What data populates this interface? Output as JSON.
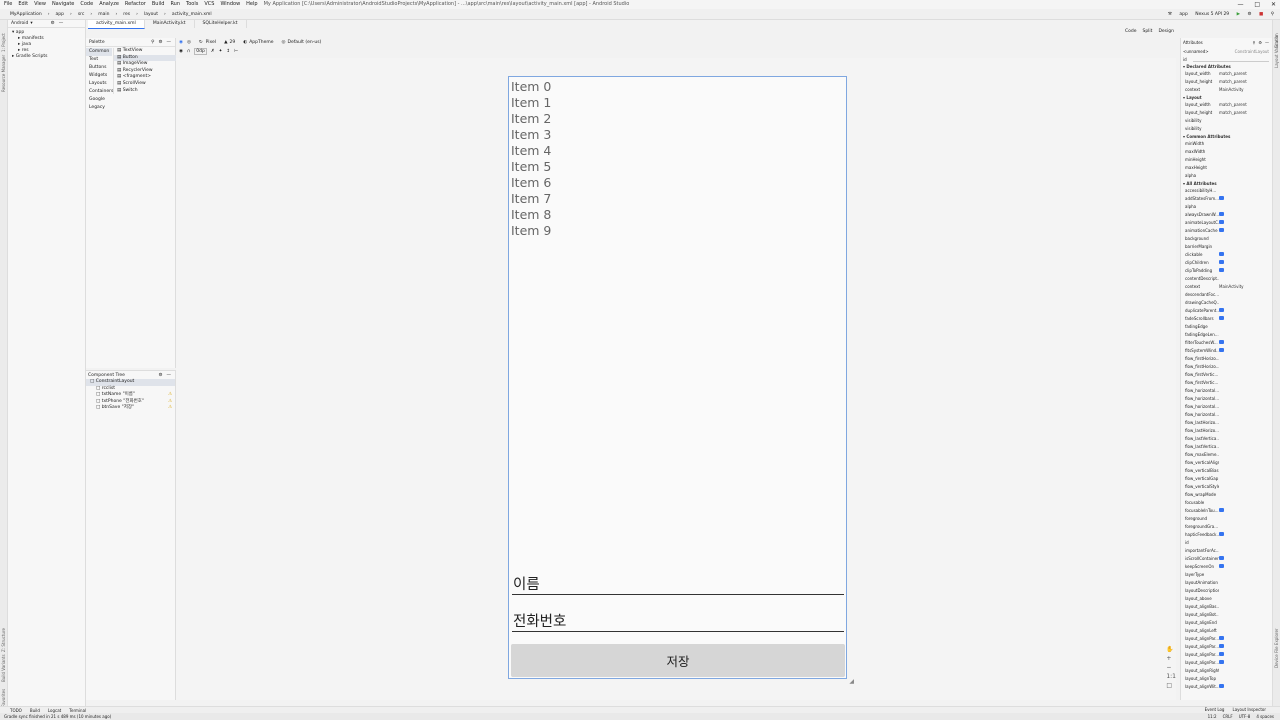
{
  "menubar": {
    "items": [
      "File",
      "Edit",
      "View",
      "Navigate",
      "Code",
      "Analyze",
      "Refactor",
      "Build",
      "Run",
      "Tools",
      "VCS",
      "Window",
      "Help"
    ],
    "title": "My Application [C:\\Users\\Administrator\\AndroidStudioProjects\\MyApplication] - ...\\app\\src\\main\\res\\layout\\activity_main.xml [app] - Android Studio"
  },
  "navbar": {
    "crumbs": [
      "MyApplication",
      "app",
      "src",
      "main",
      "res",
      "layout",
      "activity_main.xml"
    ]
  },
  "runbar": {
    "config": "app",
    "device": "Nexus 5 API 29"
  },
  "tabs": [
    "activity_main.xml",
    "MainActivity.kt",
    "SQLiteHelper.kt"
  ],
  "viewmodes": [
    "Code",
    "Split",
    "Design"
  ],
  "project": {
    "selector": "Android",
    "tree": [
      "app",
      "manifests",
      "java",
      "res",
      "Gradle Scripts"
    ]
  },
  "left_strip_labels": [
    "1: Project",
    "Resource Manager",
    "Z: Structure",
    "Build Variants",
    "2: Favorites"
  ],
  "right_strip_labels": [
    "Gradle",
    "Layout Validation",
    "Device File Explorer"
  ],
  "palette": {
    "title": "Palette",
    "categories": [
      "Common",
      "Text",
      "Buttons",
      "Widgets",
      "Layouts",
      "Containers",
      "Google",
      "Legacy"
    ],
    "items": [
      "TextView",
      "Button",
      "ImageView",
      "RecyclerView",
      "<fragment>",
      "ScrollView",
      "Switch"
    ]
  },
  "component_tree": {
    "title": "Component Tree",
    "nodes": [
      {
        "label": "ConstraintLayout",
        "warn": false
      },
      {
        "label": "rcclist",
        "warn": false
      },
      {
        "label": "txtName  \"이름\"",
        "warn": true
      },
      {
        "label": "txtPhone  \"전화번호\"",
        "warn": true
      },
      {
        "label": "btnSave  \"저장\"",
        "warn": true
      }
    ]
  },
  "design_toolbar": {
    "device": "Pixel",
    "api": "29",
    "theme": "AppTheme",
    "locale": "Default (en-us)",
    "dp": "0dp"
  },
  "preview": {
    "list_items": [
      "Item 0",
      "Item 1",
      "Item 2",
      "Item 3",
      "Item 4",
      "Item 5",
      "Item 6",
      "Item 7",
      "Item 8",
      "Item 9"
    ],
    "name_hint": "이름",
    "phone_hint": "전화번호",
    "save_label": "저장"
  },
  "attributes": {
    "title": "Attributes",
    "selected": "<unnamed>",
    "selected_type": "ConstraintLayout",
    "id_label": "id",
    "sections": [
      {
        "name": "Declared Attributes",
        "rows": [
          [
            "layout_width",
            "match_parent"
          ],
          [
            "layout_height",
            "match_parent"
          ],
          [
            "context",
            "MainActivity"
          ]
        ]
      },
      {
        "name": "Layout",
        "rows": [
          [
            "layout_width",
            "match_parent"
          ],
          [
            "layout_height",
            "match_parent"
          ],
          [
            "visibility",
            ""
          ],
          [
            "visibility",
            ""
          ]
        ]
      },
      {
        "name": "Common Attributes",
        "rows": [
          [
            "minWidth",
            ""
          ],
          [
            "maxWidth",
            ""
          ],
          [
            "minHeight",
            ""
          ],
          [
            "maxHeight",
            ""
          ],
          [
            "alpha",
            ""
          ]
        ]
      },
      {
        "name": "All Attributes",
        "rows": [
          [
            "accessibilityH...",
            ""
          ],
          [
            "addStatesFrom...",
            "cb"
          ],
          [
            "alpha",
            ""
          ],
          [
            "alwaysDrawnW...",
            "cb"
          ],
          [
            "animateLayoutC...",
            "cb"
          ],
          [
            "animationCache",
            "cb"
          ],
          [
            "background",
            ""
          ],
          [
            "barrierMargin",
            ""
          ],
          [
            "clickable",
            "cb"
          ],
          [
            "clipChildren",
            "cb"
          ],
          [
            "clipToPadding",
            "cb"
          ],
          [
            "contentDescript...",
            ""
          ],
          [
            "context",
            "MainActivity"
          ],
          [
            "descendantFoc...",
            ""
          ],
          [
            "drawingCacheQ...",
            ""
          ],
          [
            "duplicateParent...",
            "cb"
          ],
          [
            "fadeScrollbars",
            "cb"
          ],
          [
            "fadingEdge",
            ""
          ],
          [
            "fadingEdgeLen...",
            ""
          ],
          [
            "filterTouchesW...",
            "cb"
          ],
          [
            "fitsSystemWind...",
            "cb"
          ],
          [
            "flow_firstHorizo...",
            ""
          ],
          [
            "flow_firstHorizo...",
            ""
          ],
          [
            "flow_firstVertic...",
            ""
          ],
          [
            "flow_firstVertic...",
            ""
          ],
          [
            "flow_horizontal...",
            ""
          ],
          [
            "flow_horizontal...",
            ""
          ],
          [
            "flow_horizontal...",
            ""
          ],
          [
            "flow_horizontal...",
            ""
          ],
          [
            "flow_lastHorizo...",
            ""
          ],
          [
            "flow_lastHorizo...",
            ""
          ],
          [
            "flow_lastVertica...",
            ""
          ],
          [
            "flow_lastVertica...",
            ""
          ],
          [
            "flow_maxEleme...",
            ""
          ],
          [
            "flow_verticalAlign",
            ""
          ],
          [
            "flow_verticalBias",
            ""
          ],
          [
            "flow_verticalGap",
            ""
          ],
          [
            "flow_verticalStyle",
            ""
          ],
          [
            "flow_wrapMode",
            ""
          ],
          [
            "focusable",
            ""
          ],
          [
            "focusableInTou...",
            "cb"
          ],
          [
            "foreground",
            ""
          ],
          [
            "foregroundGra...",
            ""
          ],
          [
            "hapticFeedback...",
            "cb"
          ],
          [
            "id",
            ""
          ],
          [
            "importantForAc...",
            ""
          ],
          [
            "isScrollContainer",
            "cb"
          ],
          [
            "keepScreenOn",
            "cb"
          ],
          [
            "layerType",
            ""
          ],
          [
            "layoutAnimation",
            ""
          ],
          [
            "layoutDescription",
            ""
          ],
          [
            "layout_above",
            ""
          ],
          [
            "layout_alignBas...",
            ""
          ],
          [
            "layout_alignBot...",
            ""
          ],
          [
            "layout_alignEnd",
            ""
          ],
          [
            "layout_alignLeft",
            ""
          ],
          [
            "layout_alignPar...",
            "cb"
          ],
          [
            "layout_alignPar...",
            "cb"
          ],
          [
            "layout_alignPar...",
            "cb"
          ],
          [
            "layout_alignPar...",
            "cb"
          ],
          [
            "layout_alignRight",
            ""
          ],
          [
            "layout_alignTop",
            ""
          ],
          [
            "layout_alignWit...",
            "cb"
          ]
        ]
      }
    ]
  },
  "bottom_tools": [
    "TODO",
    "Build",
    "Logcat",
    "Terminal"
  ],
  "bottom_right_tools": [
    "Event Log",
    "Layout Inspector"
  ],
  "status": {
    "message": "Gradle sync finished in 21 s 489 ms (10 minutes ago)",
    "right": [
      "11:2",
      "CRLF",
      "UTF-8",
      "4 spaces"
    ]
  },
  "colors": {
    "accent": "#3574f0",
    "warning": "#d8a300",
    "button_bg": "#d6d6d6"
  }
}
